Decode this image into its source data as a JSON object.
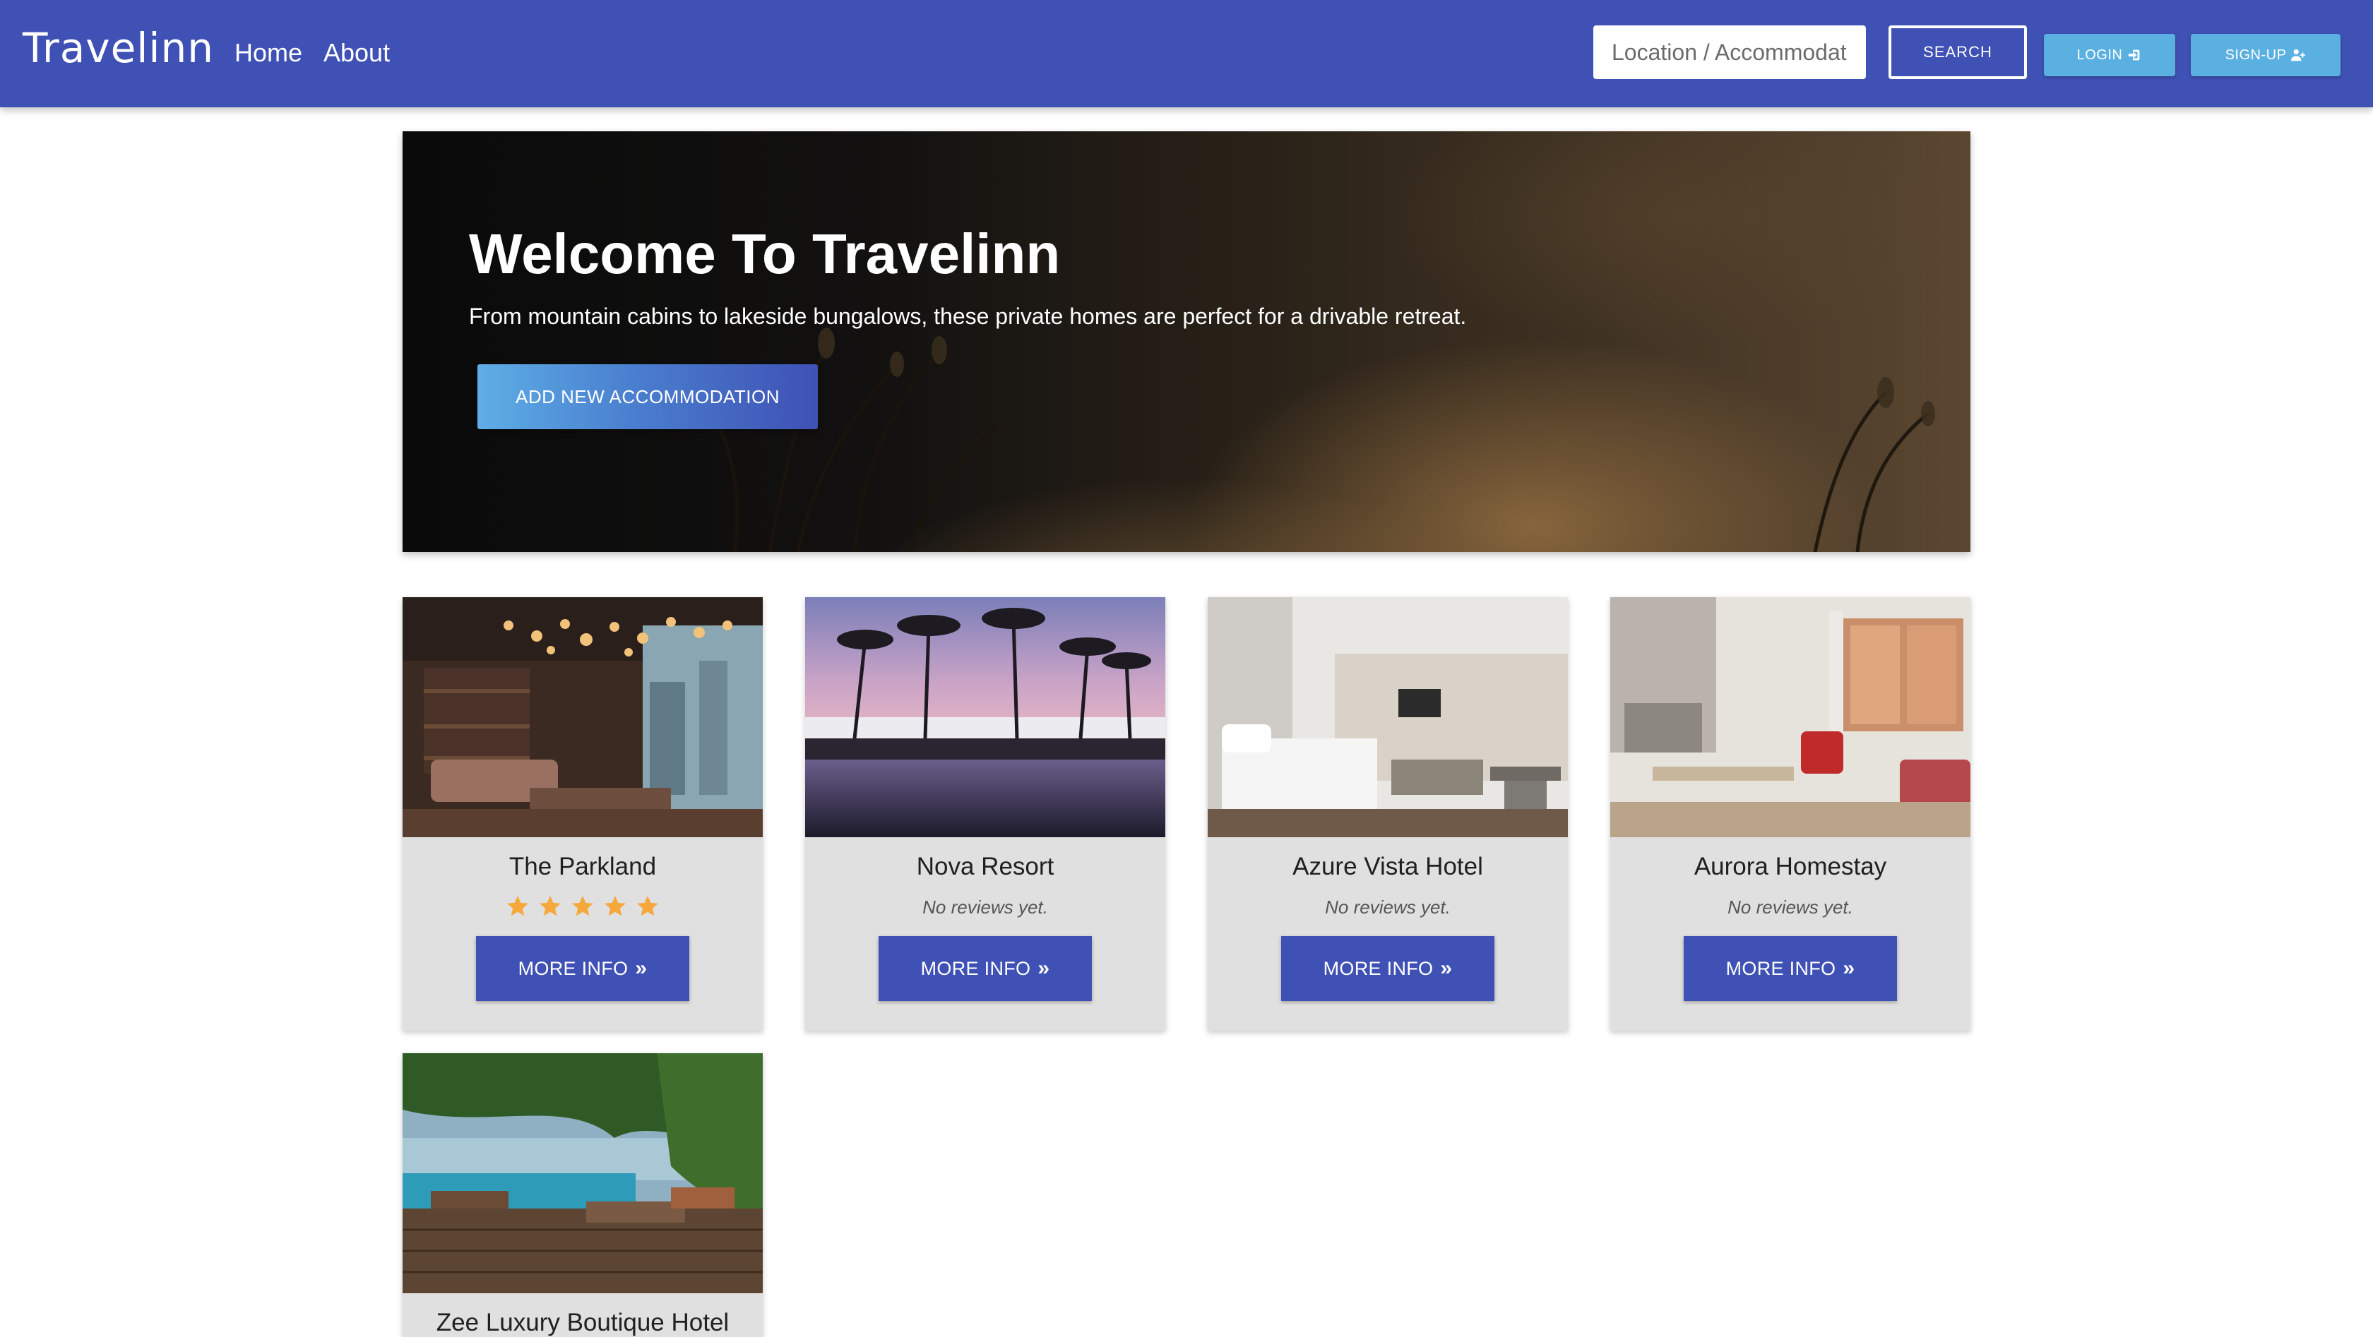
{
  "navbar": {
    "brand": "Travelinn",
    "links": [
      {
        "label": "Home"
      },
      {
        "label": "About"
      }
    ],
    "search_placeholder": "Location / Accommodation",
    "search_button": "SEARCH",
    "login_button": "LOGIN",
    "signup_button": "SIGN-UP",
    "login_icon": "sign-in-icon",
    "signup_icon": "user-plus-icon"
  },
  "hero": {
    "title": "Welcome To Travelinn",
    "subtitle": "From mountain cabins to lakeside bungalows, these private homes are perfect for a drivable retreat.",
    "button": "ADD NEW ACCOMMODATION"
  },
  "accommodations": [
    {
      "name": "The Parkland",
      "rating": 5,
      "rating_max": 5,
      "reviews_text": "",
      "button": "MORE INFO",
      "image": "hotel-lounge-photo"
    },
    {
      "name": "Nova Resort",
      "rating": null,
      "reviews_text": "No reviews yet.",
      "button": "MORE INFO",
      "image": "resort-pool-palms-photo"
    },
    {
      "name": "Azure Vista Hotel",
      "rating": null,
      "reviews_text": "No reviews yet.",
      "button": "MORE INFO",
      "image": "hotel-bedroom-photo"
    },
    {
      "name": "Aurora Homestay",
      "rating": null,
      "reviews_text": "No reviews yet.",
      "button": "MORE INFO",
      "image": "apartment-living-room-photo"
    },
    {
      "name": "Zee Luxury Boutique Hotel",
      "image": "tropical-pool-deck-photo"
    }
  ],
  "colors": {
    "primary": "#4051b5",
    "accent": "#5bb0e2",
    "star": "#f7a83b",
    "card_bg": "#e0e0e0"
  }
}
